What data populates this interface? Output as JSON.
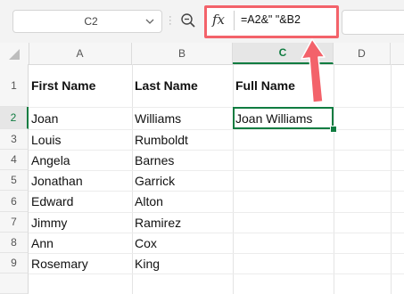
{
  "name_box": {
    "value": "C2"
  },
  "formula_bar": {
    "fx_label": "fx",
    "formula": "=A2&\" \"&B2"
  },
  "sheet": {
    "columns": [
      "A",
      "B",
      "C",
      "D"
    ],
    "active_column": "C",
    "rows": [
      "1",
      "2",
      "3",
      "4",
      "5",
      "6",
      "7",
      "8",
      "9"
    ],
    "active_row": "2",
    "headers": {
      "a1": "First Name",
      "b1": "Last Name",
      "c1": "Full Name"
    },
    "first_names": [
      "Joan",
      "Louis",
      "Angela",
      "Jonathan",
      "Edward",
      "Jimmy",
      "Ann",
      "Rosemary"
    ],
    "last_names": [
      "Williams",
      "Rumboldt",
      "Barnes",
      "Garrick",
      "Alton",
      "Ramirez",
      "Cox",
      "King"
    ],
    "full_name_c2": "Joan Williams"
  },
  "colors": {
    "accent": "#107c41",
    "highlight": "#f3626a"
  }
}
